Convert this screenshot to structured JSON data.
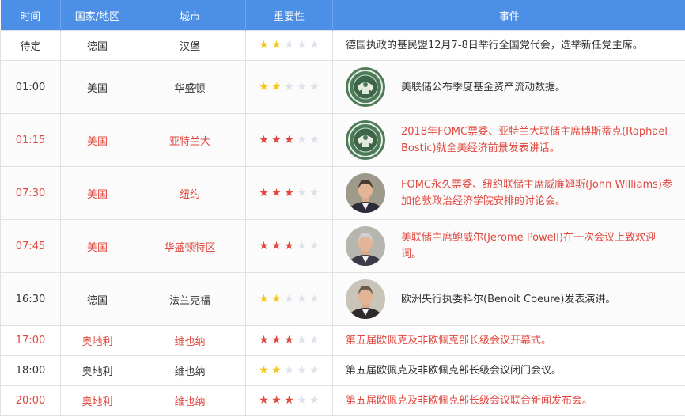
{
  "colors": {
    "header_bg": "#4b8fe6",
    "important_text": "#e0483f",
    "normal_text": "#333333",
    "star_gold": "#f5c518",
    "star_red": "#e0483f",
    "star_empty": "#dde2ea"
  },
  "headers": {
    "time": "时间",
    "country": "国家/地区",
    "city": "城市",
    "importance": "重要性",
    "event": "事件"
  },
  "rows": [
    {
      "time": "待定",
      "country": "德国",
      "city": "汉堡",
      "importance": 2,
      "event": "德国执政的基民盟12月7-8日举行全国党代会，选举新任党主席。",
      "avatar": "none",
      "important": false
    },
    {
      "time": "01:00",
      "country": "美国",
      "city": "华盛顿",
      "importance": 2,
      "event": "美联储公布季度基金资产流动数据。",
      "avatar": "fed-seal-icon",
      "important": false
    },
    {
      "time": "01:15",
      "country": "美国",
      "city": "亚特兰大",
      "importance": 3,
      "event": "2018年FOMC票委、亚特兰大联储主席博斯蒂克(Raphael Bostic)就全美经济前景发表讲话。",
      "avatar": "fed-seal-icon",
      "important": true
    },
    {
      "time": "07:30",
      "country": "美国",
      "city": "纽约",
      "importance": 3,
      "event": "FOMC永久票委、纽约联储主席威廉姆斯(John Williams)参加伦敦政治经济学院安排的讨论会。",
      "avatar": "person-portrait-icon",
      "important": true
    },
    {
      "time": "07:45",
      "country": "美国",
      "city": "华盛顿特区",
      "importance": 3,
      "event": "美联储主席鲍威尔(Jerome Powell)在一次会议上致欢迎词。",
      "avatar": "person-portrait-icon",
      "important": true
    },
    {
      "time": "16:30",
      "country": "德国",
      "city": "法兰克福",
      "importance": 2,
      "event": "欧洲央行执委科尔(Benoit Coeure)发表演讲。",
      "avatar": "person-portrait-icon",
      "important": false
    },
    {
      "time": "17:00",
      "country": "奥地利",
      "city": "维也纳",
      "importance": 3,
      "event": "第五届欧佩克及非欧佩克部长级会议开幕式。",
      "avatar": "none",
      "important": true
    },
    {
      "time": "18:00",
      "country": "奥地利",
      "city": "维也纳",
      "importance": 2,
      "event": "第五届欧佩克及非欧佩克部长级会议闭门会议。",
      "avatar": "none",
      "important": false
    },
    {
      "time": "20:00",
      "country": "奥地利",
      "city": "维也纳",
      "importance": 3,
      "event": "第五届欧佩克及非欧佩克部长级会议联合新闻发布会。",
      "avatar": "none",
      "important": true
    }
  ]
}
